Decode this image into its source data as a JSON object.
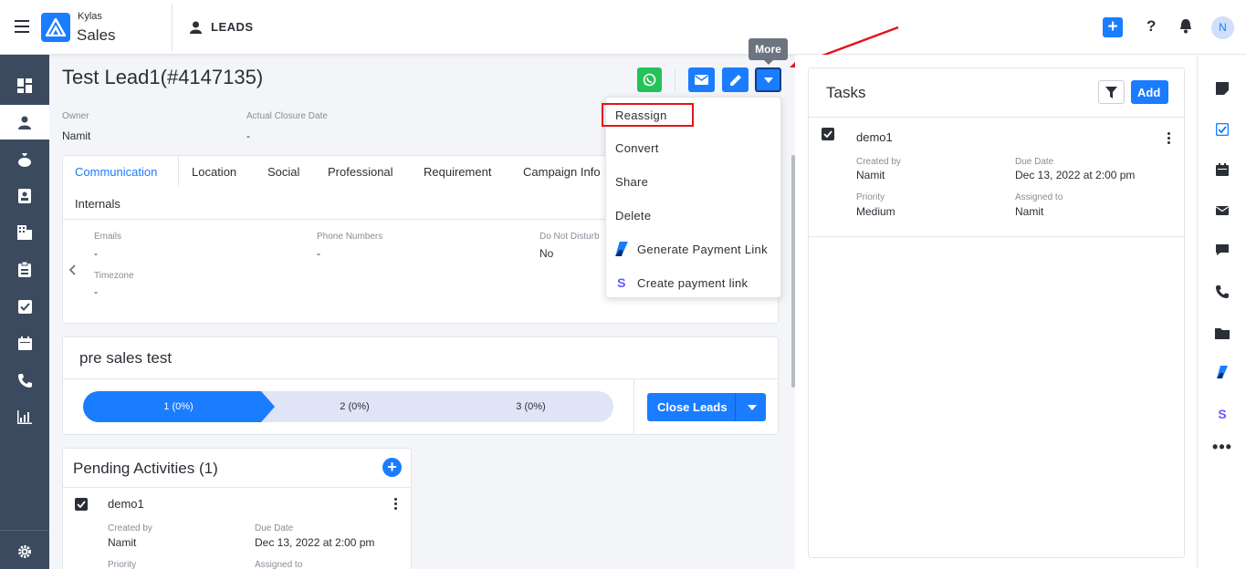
{
  "header": {
    "brand_top": "Kylas",
    "brand_bottom": "Sales",
    "section_title": "LEADS",
    "help_label": "?",
    "avatar_initial": "N",
    "accent_color": "#1a7cff"
  },
  "lead": {
    "title": "Test Lead1(#4147135)",
    "owner_label": "Owner",
    "owner_value": "Namit",
    "closure_label": "Actual Closure Date",
    "closure_value": "-"
  },
  "tooltip": "More",
  "tabs": [
    "Communication",
    "Location",
    "Social",
    "Professional",
    "Requirement",
    "Campaign Info",
    "Internals"
  ],
  "communication": {
    "emails_label": "Emails",
    "emails_value": "-",
    "phones_label": "Phone Numbers",
    "phones_value": "-",
    "dnd_label": "Do Not Disturb",
    "dnd_value": "No",
    "timezone_label": "Timezone",
    "timezone_value": "-"
  },
  "pipeline": {
    "title": "pre sales test",
    "stages": [
      "1 (0%)",
      "2 (0%)",
      "3 (0%)"
    ],
    "close_button": "Close Leads"
  },
  "pending": {
    "title": "Pending Activities (1)",
    "item": {
      "name": "demo1",
      "created_by_label": "Created by",
      "created_by": "Namit",
      "due_label": "Due Date",
      "due": "Dec 13, 2022 at 2:00 pm",
      "priority_label": "Priority",
      "assigned_label": "Assigned to"
    }
  },
  "tasks": {
    "title": "Tasks",
    "add_label": "Add",
    "item": {
      "name": "demo1",
      "created_by_label": "Created by",
      "created_by": "Namit",
      "due_label": "Due Date",
      "due": "Dec 13, 2022 at 2:00 pm",
      "priority_label": "Priority",
      "priority": "Medium",
      "assigned_label": "Assigned to",
      "assigned": "Namit"
    }
  },
  "more_menu": [
    "Reassign",
    "Convert",
    "Share",
    "Delete",
    "Generate Payment Link",
    "Create payment link"
  ]
}
